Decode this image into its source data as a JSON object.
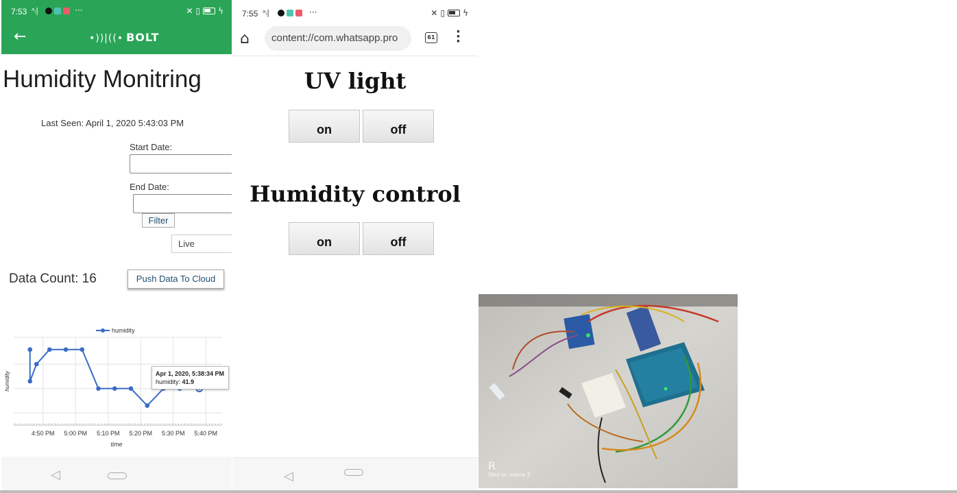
{
  "phone1": {
    "status": {
      "time": "7:53",
      "more": "···"
    },
    "appbar": {
      "back_icon": "arrow-left-icon",
      "brand": "BOLT",
      "brand_mark": "•))|((•"
    },
    "title": "Humidity Monitring",
    "last_seen": "Last Seen: April 1, 2020 5:43:03 PM",
    "start_date_label": "Start Date:",
    "end_date_label": "End Date:",
    "filter_label": "Filter",
    "mode_select": "Live",
    "data_count": "Data Count: 16",
    "push_button": "Push Data To Cloud",
    "tooltip": {
      "date": "Apr 1, 2020, 5:38:34 PM",
      "label": "humidity: ",
      "value": "41.9"
    }
  },
  "chart_data": {
    "type": "line",
    "legend": "humidity",
    "legend_position": "top",
    "xlabel": "time",
    "ylabel": "humidity",
    "x_ticks": [
      "4:50 PM",
      "5:00 PM",
      "5:10 PM",
      "5:20 PM",
      "5:30 PM",
      "5:40 PM"
    ],
    "grid": true,
    "color": "#3a6cc8",
    "series": [
      {
        "name": "humidity",
        "x": [
          "4:46 PM",
          "4:46 PM",
          "4:46 PM",
          "4:48 PM",
          "4:52 PM",
          "4:57 PM",
          "5:02 PM",
          "5:07 PM",
          "5:12 PM",
          "5:17 PM",
          "5:22 PM",
          "5:27 PM",
          "5:32 PM",
          "5:38 PM"
        ],
        "y": [
          43.5,
          43.5,
          42.2,
          42.9,
          43.5,
          43.5,
          43.5,
          41.9,
          41.9,
          41.9,
          41.2,
          41.9,
          41.9,
          41.9
        ]
      }
    ]
  },
  "phone2": {
    "status": {
      "time": "7:55",
      "more": "···"
    },
    "url": "content://com.whatsapp.pro",
    "tab_count": "61",
    "heading_uv": "UV light",
    "heading_humidity": "Humidity control",
    "on_label": "on",
    "off_label": "off"
  },
  "photo": {
    "watermark_logo": "R",
    "watermark_text": "Shot on realme 3"
  },
  "colors": {
    "bolt_green": "#2aa557",
    "chart_line": "#3a6cc8"
  }
}
